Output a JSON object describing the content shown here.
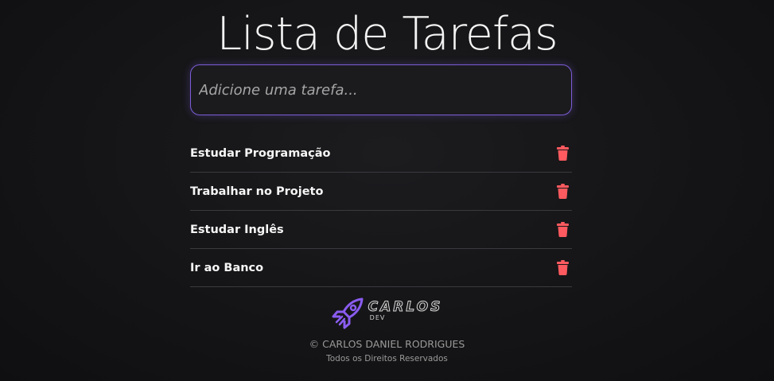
{
  "header": {
    "title": "Lista de Tarefas"
  },
  "input": {
    "placeholder": "Adicione uma tarefa...",
    "accent_color": "#7c5cd6"
  },
  "tasks": [
    {
      "label": "Estudar Programação",
      "action_icon": "trash-icon"
    },
    {
      "label": "Trabalhar no Projeto",
      "action_icon": "trash-icon"
    },
    {
      "label": "Estudar Inglês",
      "action_icon": "trash-icon"
    },
    {
      "label": "Ir ao Banco",
      "action_icon": "trash-icon"
    }
  ],
  "footer": {
    "logo_name": "CARLOS",
    "logo_sub": "DEV",
    "logo_icon": "rocket-icon",
    "copyright": "© CARLOS DANIEL RODRIGUES",
    "rights": "Todos os Direitos Reservados"
  },
  "colors": {
    "delete_icon": "#ff5a5f",
    "logo_accent": "#8a5cf0"
  }
}
